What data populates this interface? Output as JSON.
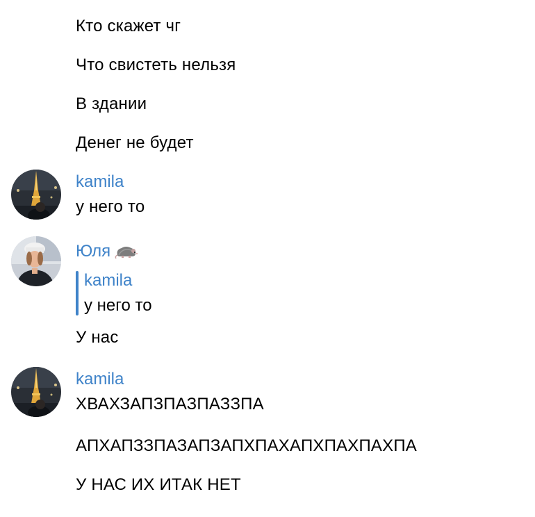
{
  "messages_top": [
    {
      "text": "Кто скажет чг"
    },
    {
      "text": "Что свистеть нельзя"
    },
    {
      "text": "В здании"
    },
    {
      "text": "Денег не будет"
    }
  ],
  "group1": {
    "sender": "kamila",
    "avatar_icon": "eiffel-tower-night-avatar",
    "text": "у него то"
  },
  "group2": {
    "sender": "Юля",
    "sender_icon": "rat-emoji-icon",
    "avatar_icon": "person-in-hat-avatar",
    "reply": {
      "sender": "kamila",
      "text": "у него то"
    },
    "text": "У нас"
  },
  "group3": {
    "sender": "kamila",
    "avatar_icon": "eiffel-tower-night-avatar",
    "messages": [
      {
        "text": "ХВАХЗАПЗПАЗПАЗЗПА"
      },
      {
        "text": "АПХАПЗЗПАЗАПЗАПХПАХАПХПАХПАХПА"
      },
      {
        "text": "У НАС ИХ ИТАК НЕТ"
      }
    ]
  },
  "colors": {
    "accent": "#3f83c9",
    "text": "#000000",
    "background": "#ffffff"
  }
}
